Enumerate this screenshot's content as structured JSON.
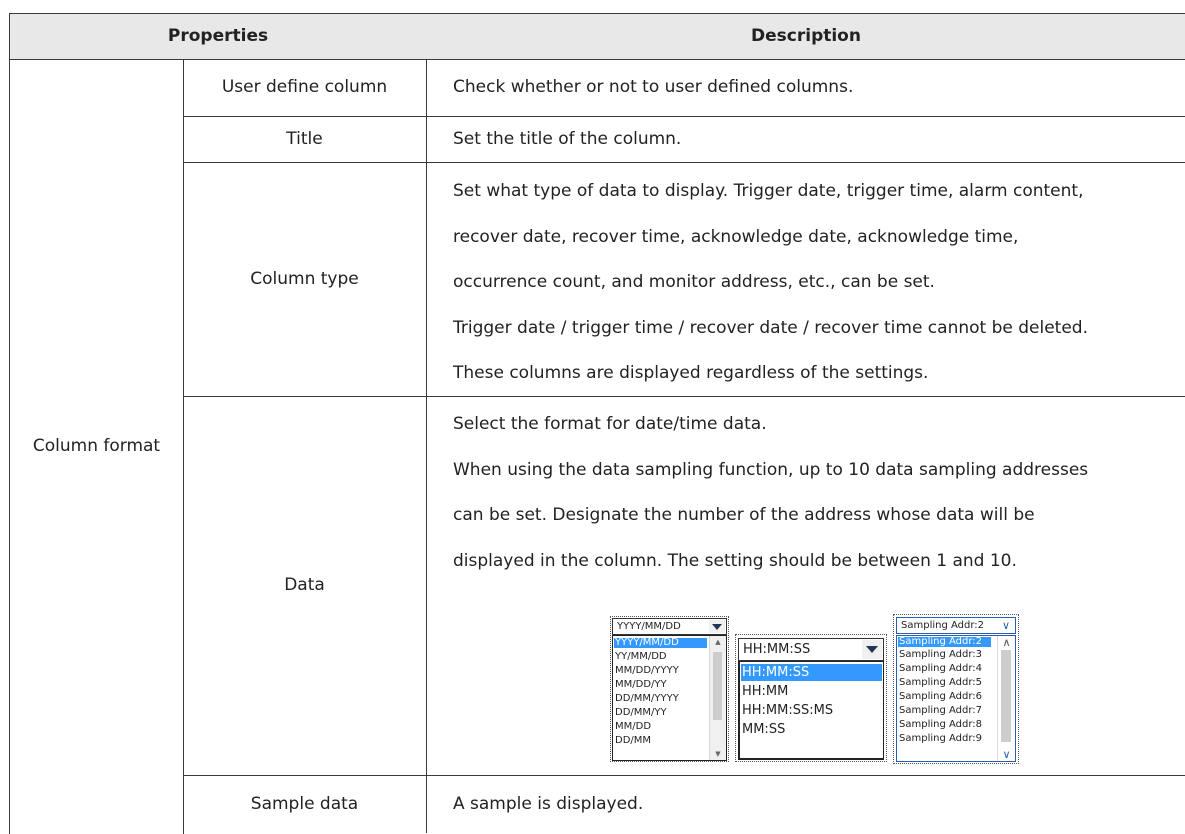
{
  "header": {
    "properties": "Properties",
    "description": "Description"
  },
  "group": "Column format",
  "rows": {
    "user_define_column": {
      "name": "User define column",
      "desc": "Check whether or not to user defined columns."
    },
    "title": {
      "name": "Title",
      "desc": "Set the title of the column."
    },
    "column_type": {
      "name": "Column type",
      "lines": [
        "Set what type of data to display. Trigger date, trigger time, alarm content,",
        "recover date, recover time, acknowledge date, acknowledge time,",
        "occurrence count, and monitor address, etc., can be set.",
        "Trigger date / trigger time / recover date / recover time cannot be deleted.",
        "These columns are displayed regardless of the settings."
      ]
    },
    "data": {
      "name": "Data",
      "lines": [
        "Select the format for date/time data.",
        "When using the data sampling function, up to 10 data sampling addresses",
        "can be set. Designate the number of the address whose data will be",
        "displayed in the column. The setting should be between 1 and 10."
      ]
    },
    "sample_data": {
      "name": "Sample data",
      "desc": "A sample is displayed."
    }
  },
  "date_dropdown": {
    "selected": "YYYY/MM/DD",
    "options": [
      "YYYY/MM/DD",
      "YY/MM/DD",
      "MM/DD/YYYY",
      "MM/DD/YY",
      "DD/MM/YYYY",
      "DD/MM/YY",
      "MM/DD",
      "DD/MM"
    ],
    "highlighted": "YYYY/MM/DD"
  },
  "time_dropdown": {
    "selected": "HH:MM:SS",
    "options": [
      "HH:MM:SS",
      "HH:MM",
      "HH:MM:SS:MS",
      "MM:SS"
    ],
    "highlighted": "HH:MM:SS"
  },
  "sampling_dropdown": {
    "selected": "Sampling Addr:2",
    "options": [
      "Sampling Addr:2",
      "Sampling Addr:3",
      "Sampling Addr:4",
      "Sampling Addr:5",
      "Sampling Addr:6",
      "Sampling Addr:7",
      "Sampling Addr:8",
      "Sampling Addr:9"
    ],
    "highlighted": "Sampling Addr:2"
  },
  "icons": {
    "combo_arrow": "triangle-down",
    "sampling_arrow": "chevron-down",
    "scroll_up": "scroll-up-arrow",
    "scroll_down": "scroll-down-arrow"
  },
  "colors": {
    "header_bg": "#e8e8e8",
    "selection": "#3399ff",
    "border": "#3a3a3a"
  }
}
